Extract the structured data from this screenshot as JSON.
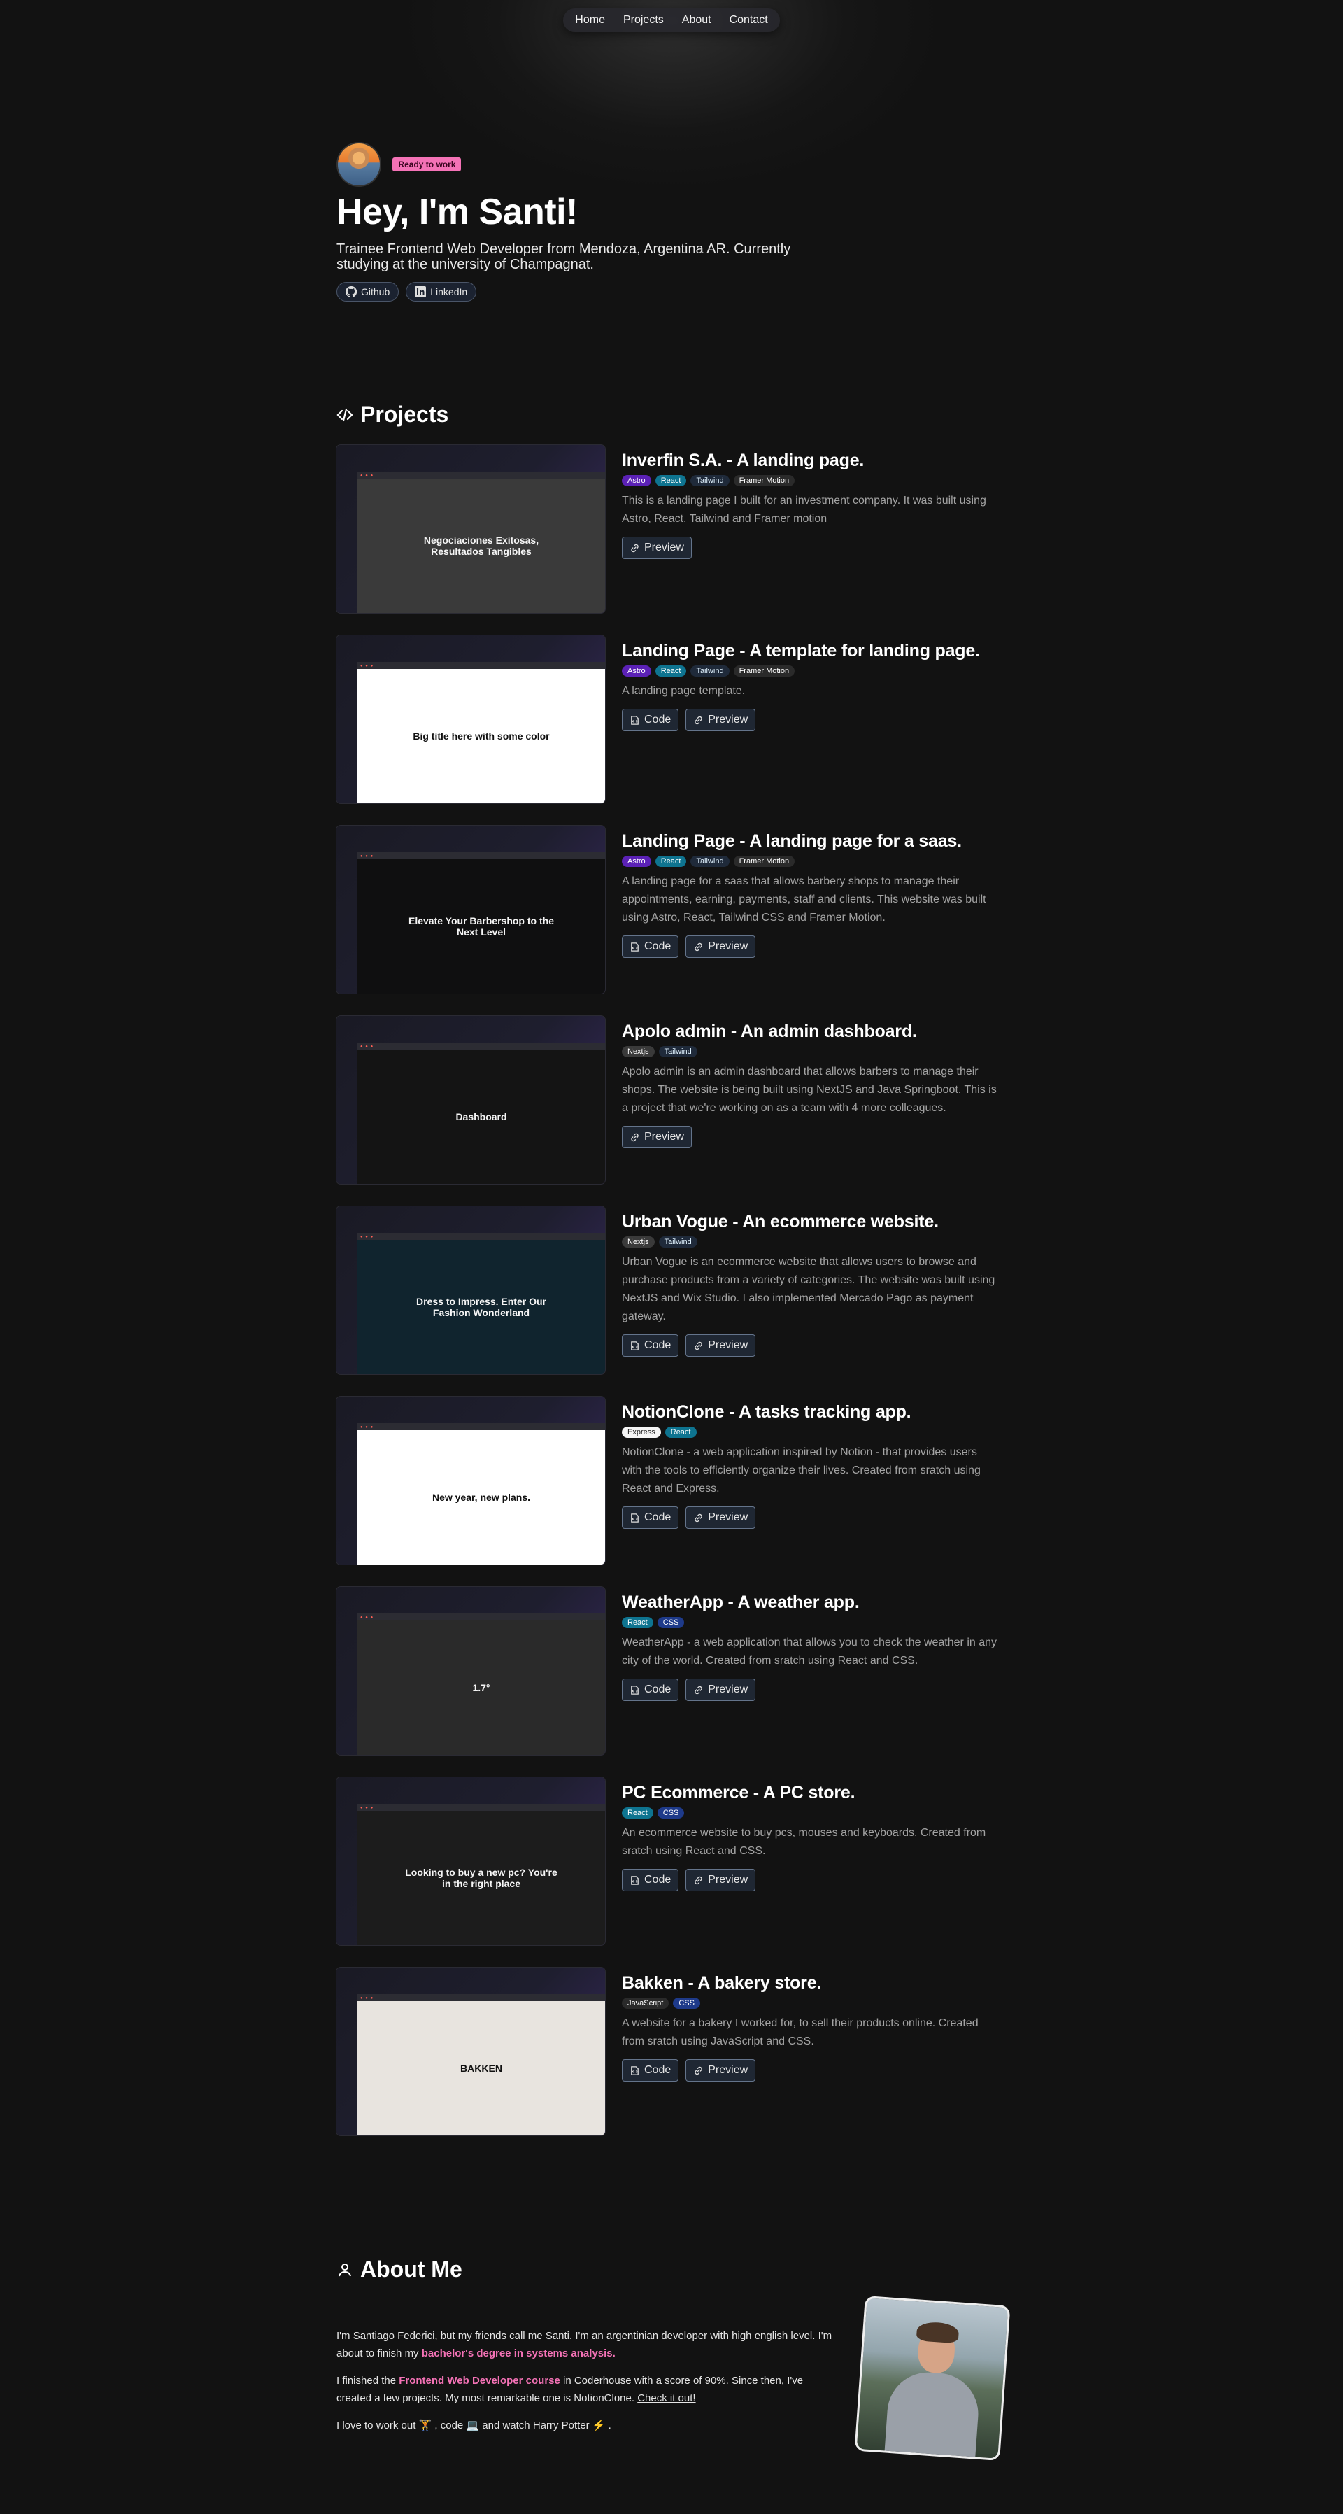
{
  "nav": {
    "items": [
      "Home",
      "Projects",
      "About",
      "Contact"
    ]
  },
  "hero": {
    "badge": "Ready to work",
    "title": "Hey, I'm Santi!",
    "subtitle": "Trainee Frontend Web Developer from Mendoza, Argentina AR. Currently studying at the university of Champagnat.",
    "links": [
      {
        "label": "Github",
        "icon": "github-icon"
      },
      {
        "label": "LinkedIn",
        "icon": "linkedin-icon"
      }
    ]
  },
  "projects_section": {
    "title": "Projects",
    "icon": "code-icon"
  },
  "projects": [
    {
      "title": "Inverfin S.A. - A landing page.",
      "tags": [
        "Astro",
        "React",
        "Tailwind",
        "Framer Motion"
      ],
      "desc": "This is a landing page I built for an investment company. It was built using Astro, React, Tailwind and Framer motion",
      "buttons": [
        "Preview"
      ],
      "screen_text": "Negociaciones Exitosas, Resultados Tangibles",
      "screen_bg": "#3a3a3a"
    },
    {
      "title": "Landing Page - A template for landing page.",
      "tags": [
        "Astro",
        "React",
        "Tailwind",
        "Framer Motion"
      ],
      "desc": "A landing page template.",
      "buttons": [
        "Code",
        "Preview"
      ],
      "screen_text": "Big title here with some color",
      "screen_bg": "#ffffff"
    },
    {
      "title": "Landing Page - A landing page for a saas.",
      "tags": [
        "Astro",
        "React",
        "Tailwind",
        "Framer Motion"
      ],
      "desc": "A landing page for a saas that allows barbery shops to manage their appointments, earning, payments, staff and clients. This website was built using Astro, React, Tailwind CSS and Framer Motion.",
      "buttons": [
        "Code",
        "Preview"
      ],
      "screen_text": "Elevate Your Barbershop to the Next Level",
      "screen_bg": "#0f0f10"
    },
    {
      "title": "Apolo admin - An admin dashboard.",
      "tags": [
        "Nextjs",
        "Tailwind"
      ],
      "desc": "Apolo admin is an admin dashboard that allows barbers to manage their shops. The website is being built using NextJS and Java Springboot. This is a project that we're working on as a team with 4 more colleagues.",
      "buttons": [
        "Preview"
      ],
      "screen_text": "Dashboard",
      "screen_bg": "#141414"
    },
    {
      "title": "Urban Vogue - An ecommerce website.",
      "tags": [
        "Nextjs",
        "Tailwind"
      ],
      "desc": "Urban Vogue is an ecommerce website that allows users to browse and purchase products from a variety of categories. The website was built using NextJS and Wix Studio. I also implemented Mercado Pago as payment gateway.",
      "buttons": [
        "Code",
        "Preview"
      ],
      "screen_text": "Dress to Impress. Enter Our Fashion Wonderland",
      "screen_bg": "#10242e"
    },
    {
      "title": "NotionClone - A tasks tracking app.",
      "tags": [
        "Express",
        "React"
      ],
      "desc": "NotionClone - a web application inspired by Notion - that provides users with the tools to efficiently organize their lives. Created from sratch using React and Express.",
      "buttons": [
        "Code",
        "Preview"
      ],
      "screen_text": "New year, new plans.",
      "screen_bg": "#ffffff"
    },
    {
      "title": "WeatherApp - A weather app.",
      "tags": [
        "React",
        "CSS"
      ],
      "desc": "WeatherApp - a web application that allows you to check the weather in any city of the world. Created from sratch using React and CSS.",
      "buttons": [
        "Code",
        "Preview"
      ],
      "screen_text": "1.7°",
      "screen_bg": "#2a2a2a"
    },
    {
      "title": "PC Ecommerce - A PC store.",
      "tags": [
        "React",
        "CSS"
      ],
      "desc": "An ecommerce website to buy pcs, mouses and keyboards. Created from sratch using React and CSS.",
      "buttons": [
        "Code",
        "Preview"
      ],
      "screen_text": "Looking to buy a new pc? You're in the right place",
      "screen_bg": "#1c1c1c"
    },
    {
      "title": "Bakken - A bakery store.",
      "tags": [
        "JavaScript",
        "CSS"
      ],
      "desc": "A website for a bakery I worked for, to sell their products online. Created from sratch using JavaScript and CSS.",
      "buttons": [
        "Code",
        "Preview"
      ],
      "screen_text": "BAKKEN",
      "screen_bg": "#e8e4df"
    }
  ],
  "about": {
    "title": "About Me",
    "icon": "user-icon",
    "p1_a": "I'm Santiago Federici, but my friends call me Santi. I'm an argentinian developer with high english level. I'm about to finish my ",
    "p1_hl": "bachelor's degree in systems analysis.",
    "p2_a": "I finished the ",
    "p2_hl": "Frontend Web Developer course",
    "p2_b": " in Coderhouse with a score of 90%. Since then, I've created a few projects. My most remarkable one is NotionClone. ",
    "p2_link": "Check it out!",
    "p3": "I love to work out 🏋 , code 💻 and watch Harry Potter ⚡ ."
  }
}
